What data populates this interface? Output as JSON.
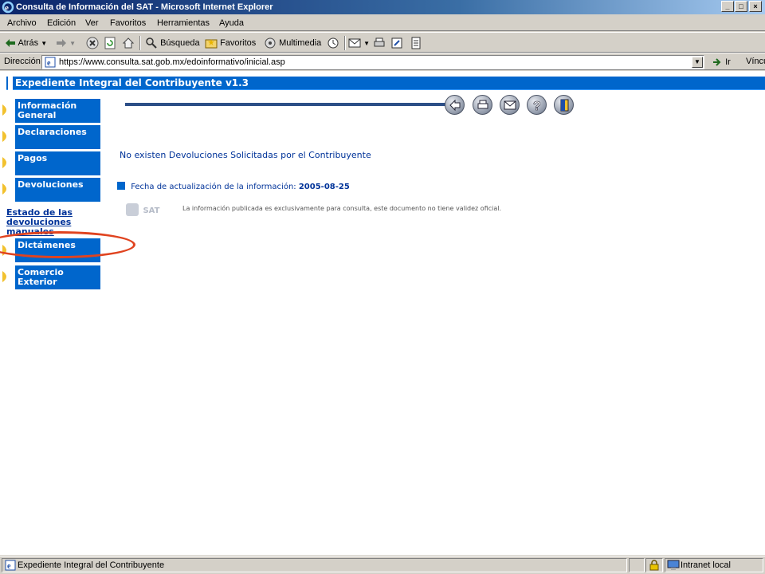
{
  "window": {
    "title": "Consulta de Información del SAT - Microsoft Internet Explorer"
  },
  "menu": {
    "items": [
      "Archivo",
      "Edición",
      "Ver",
      "Favoritos",
      "Herramientas",
      "Ayuda"
    ]
  },
  "toolbar": {
    "back_label": "Atrás",
    "search_label": "Búsqueda",
    "favorites_label": "Favoritos",
    "multimedia_label": "Multimedia"
  },
  "address": {
    "label": "Dirección",
    "url": "https://www.consulta.sat.gob.mx/edoinformativo/inicial.asp",
    "go_label": "Ir",
    "links_label": "Vínculos"
  },
  "page": {
    "header": "Expediente Integral del Contribuyente v1.3",
    "nav": [
      {
        "label": "Información General"
      },
      {
        "label": "Declaraciones"
      },
      {
        "label": "Pagos"
      },
      {
        "label": "Devoluciones"
      },
      {
        "label": "Dictámenes"
      },
      {
        "label": "Comercio Exterior"
      }
    ],
    "nav_link": "Estado de las devoluciones manuales",
    "message": "No existen Devoluciones Solicitadas por el Contribuyente",
    "update_label": "Fecha de actualización de la información:",
    "update_date": "2005-08-25",
    "logo_text": "SAT",
    "disclaimer": "La información publicada es exclusivamente para consulta, este documento no tiene validez oficial.",
    "action_icons": [
      "back-arrow-icon",
      "printer-icon",
      "mail-icon",
      "help-icon",
      "exit-door-icon"
    ]
  },
  "status": {
    "text": "Expediente Integral del Contribuyente",
    "zone": "Intranet local"
  },
  "colors": {
    "accent_blue": "#0066cc",
    "link_blue": "#003399",
    "highlight_oval": "#e0431f"
  }
}
